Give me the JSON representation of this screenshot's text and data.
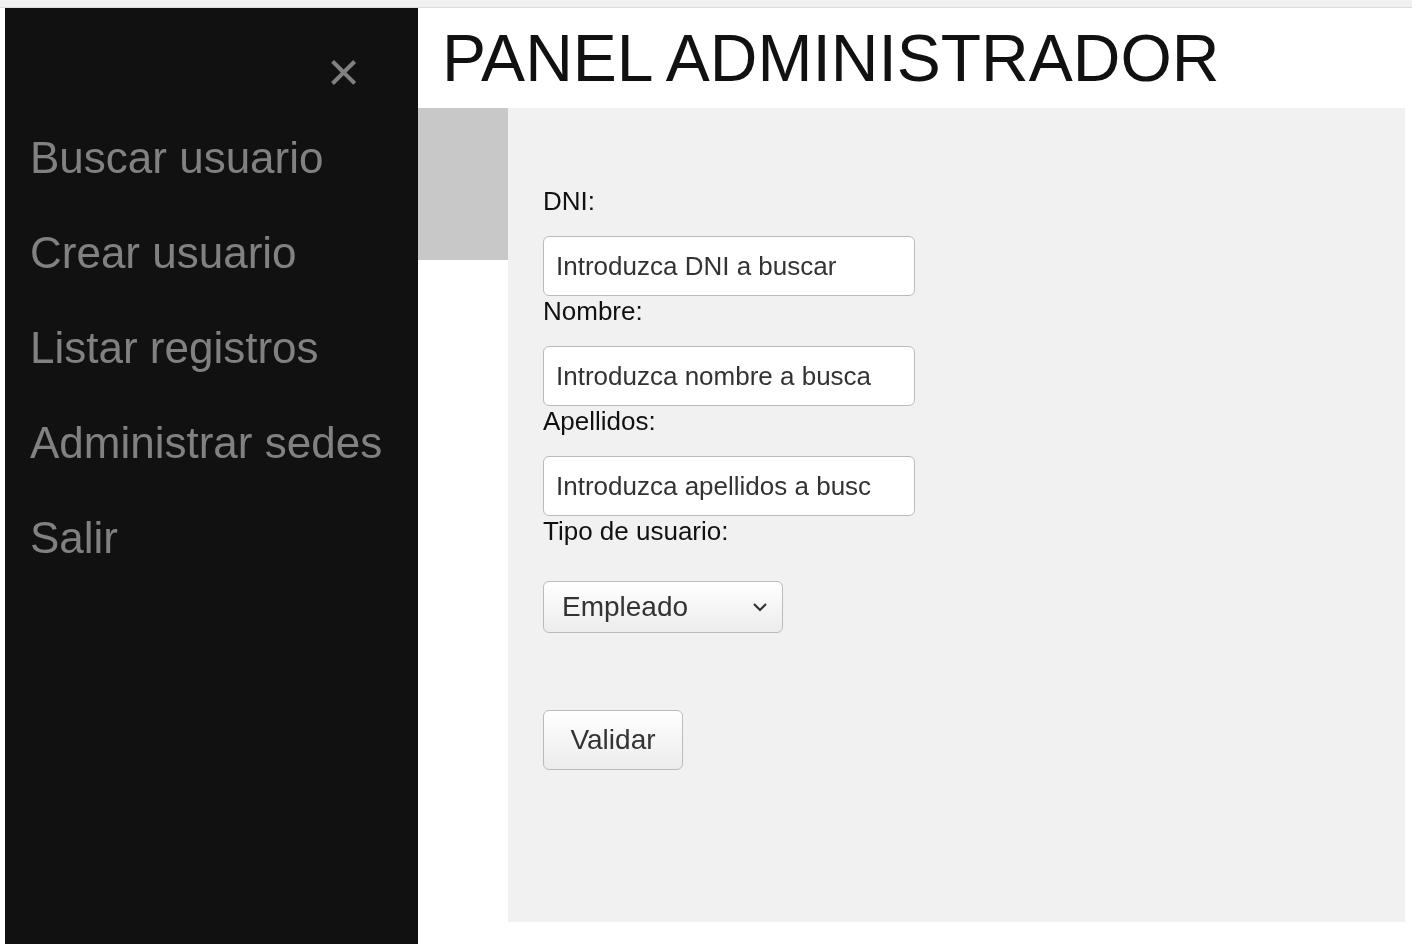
{
  "sidebar": {
    "close": "×",
    "items": [
      "Buscar usuario",
      "Crear usuario",
      "Listar registros",
      "Administrar sedes",
      "Salir"
    ]
  },
  "title": "PANEL ADMINISTRADOR",
  "form": {
    "fields": [
      {
        "kind": "text",
        "label": "DNI:",
        "placeholder": "Introduzca DNI a buscar"
      },
      {
        "kind": "text",
        "label": "Nombre:",
        "placeholder": "Introduzca nombre a busca"
      },
      {
        "kind": "text",
        "label": "Apellidos:",
        "placeholder": "Introduzca apellidos a busc"
      },
      {
        "kind": "select",
        "label": "Tipo de usuario:",
        "value": "Empleado"
      }
    ],
    "submit": "Validar"
  }
}
